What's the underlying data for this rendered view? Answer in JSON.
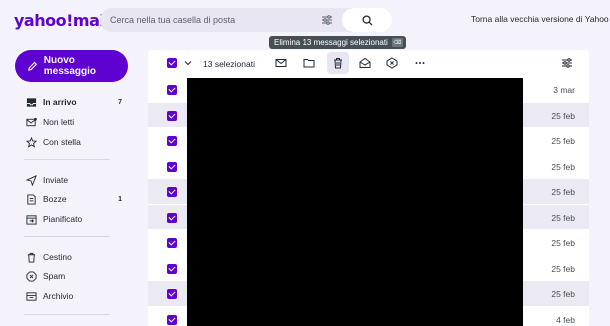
{
  "header": {
    "logo": "yahoo!mail",
    "search_placeholder": "Cerca nella tua casella di posta",
    "back_link": "Torna alla vecchia versione di Yahoo M"
  },
  "sidebar": {
    "compose_label": "Nuovo messaggio",
    "items": [
      {
        "label": "In arrivo",
        "count": "7",
        "icon": "inbox-icon"
      },
      {
        "label": "Non letti",
        "count": "",
        "icon": "unread-icon"
      },
      {
        "label": "Con stella",
        "count": "",
        "icon": "star-icon"
      },
      {
        "label": "Inviate",
        "count": "",
        "icon": "send-icon"
      },
      {
        "label": "Bozze",
        "count": "1",
        "icon": "draft-icon"
      },
      {
        "label": "Pianificato",
        "count": "",
        "icon": "schedule-icon"
      },
      {
        "label": "Cestino",
        "count": "",
        "icon": "trash-icon"
      },
      {
        "label": "Spam",
        "count": "",
        "icon": "spam-icon"
      },
      {
        "label": "Archivio",
        "count": "",
        "icon": "archive-icon"
      }
    ]
  },
  "toolbar": {
    "selected_label": "13 selezionati",
    "tooltip": "Elimina 13 messaggi selezionati",
    "tooltip_key": "⌫"
  },
  "messages": [
    {
      "date": "3 mar",
      "shade": "#ffffff"
    },
    {
      "date": "25 feb",
      "shade": "#ebe9f2"
    },
    {
      "date": "25 feb",
      "shade": "#ffffff"
    },
    {
      "date": "25 feb",
      "shade": "#ffffff"
    },
    {
      "date": "25 feb",
      "shade": "#ebe9f2"
    },
    {
      "date": "25 feb",
      "shade": "#ebe9f2"
    },
    {
      "date": "25 feb",
      "shade": "#ffffff"
    },
    {
      "date": "25 feb",
      "shade": "#ffffff"
    },
    {
      "date": "25 feb",
      "shade": "#ebe9f2"
    },
    {
      "date": "4 feb",
      "shade": "#ffffff"
    }
  ],
  "colors": {
    "accent": "#5f01d1",
    "background": "#f4f2fb"
  }
}
